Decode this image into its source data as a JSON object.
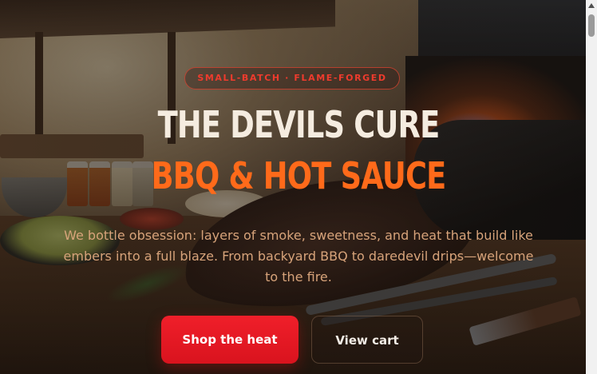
{
  "hero": {
    "badge": "SMALL-BATCH · FLAME-FORGED",
    "title_line1": "THE DEVILS CURE",
    "title_line2": "BBQ & HOT SAUCE",
    "description": "We bottle obsession: layers of smoke, sweetness, and heat that build like embers into a full blaze. From backyard BBQ to daredevil drips—welcome to the fire.",
    "primary_cta": "Shop the heat",
    "secondary_cta": "View cart"
  },
  "colors": {
    "title_light": "#f5ece0",
    "title_accent": "#ff6a1a",
    "badge_red": "#ef3b2d",
    "primary_button": "#e8182a",
    "description_text": "#d7a37a"
  },
  "icons": {
    "scroll_up": "chevron-up-icon"
  }
}
